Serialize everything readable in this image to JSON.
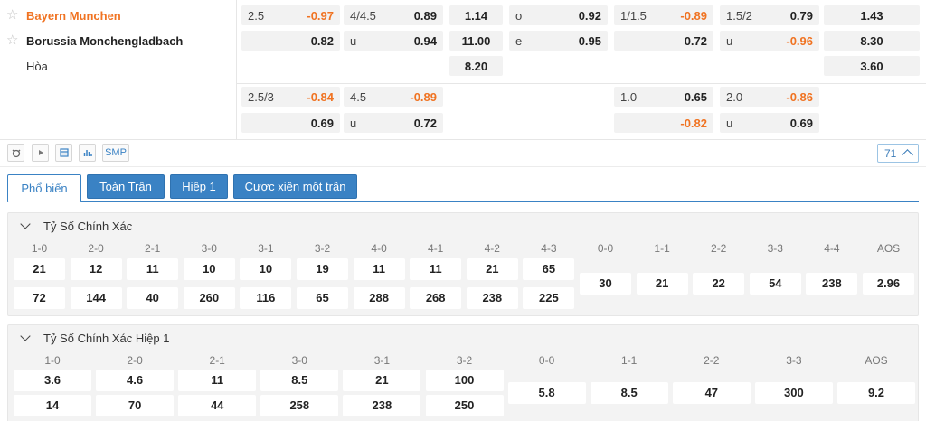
{
  "match": {
    "home": "Bayern Munchen",
    "away": "Borussia Monchengladbach",
    "draw": "Hòa"
  },
  "odds_rows": [
    [
      {
        "col": 0,
        "label": "2.5",
        "value": "-0.97",
        "neg": true
      },
      {
        "col": 1,
        "label": "4/4.5",
        "value": "0.89",
        "neg": false
      },
      {
        "col": 2,
        "label": "",
        "value": "1.14",
        "neg": false
      },
      {
        "col": 3,
        "label": "o",
        "value": "0.92",
        "neg": false
      },
      {
        "col": 4,
        "label": "1/1.5",
        "value": "-0.89",
        "neg": true
      },
      {
        "col": 5,
        "label": "1.5/2",
        "value": "0.79",
        "neg": false
      },
      {
        "col": 6,
        "label": "",
        "value": "1.43",
        "neg": false
      }
    ],
    [
      {
        "col": 0,
        "label": "",
        "value": "0.82",
        "neg": false
      },
      {
        "col": 1,
        "label": "u",
        "value": "0.94",
        "neg": false
      },
      {
        "col": 2,
        "label": "",
        "value": "11.00",
        "neg": false
      },
      {
        "col": 3,
        "label": "e",
        "value": "0.95",
        "neg": false
      },
      {
        "col": 4,
        "label": "",
        "value": "0.72",
        "neg": false
      },
      {
        "col": 5,
        "label": "u",
        "value": "-0.96",
        "neg": true
      },
      {
        "col": 6,
        "label": "",
        "value": "8.30",
        "neg": false
      }
    ],
    [
      {
        "col": 2,
        "label": "",
        "value": "8.20",
        "neg": false
      },
      {
        "col": 6,
        "label": "",
        "value": "3.60",
        "neg": false
      }
    ],
    [
      {
        "col": 0,
        "label": "2.5/3",
        "value": "-0.84",
        "neg": true
      },
      {
        "col": 1,
        "label": "4.5",
        "value": "-0.89",
        "neg": true
      },
      {
        "col": 4,
        "label": "1.0",
        "value": "0.65",
        "neg": false
      },
      {
        "col": 5,
        "label": "2.0",
        "value": "-0.86",
        "neg": true
      }
    ],
    [
      {
        "col": 0,
        "label": "",
        "value": "0.69",
        "neg": false
      },
      {
        "col": 1,
        "label": "u",
        "value": "0.72",
        "neg": false
      },
      {
        "col": 4,
        "label": "",
        "value": "-0.82",
        "neg": true
      },
      {
        "col": 5,
        "label": "u",
        "value": "0.69",
        "neg": false
      }
    ]
  ],
  "toolbar": {
    "smp_label": "SMP",
    "count": "71"
  },
  "tabs": [
    "Phổ biến",
    "Toàn Trận",
    "Hiệp 1",
    "Cược xiên một trận"
  ],
  "section1": {
    "title": "Tỷ Số Chính Xác",
    "home_cols": [
      "1-0",
      "2-0",
      "2-1",
      "3-0",
      "3-1",
      "3-2",
      "4-0",
      "4-1",
      "4-2",
      "4-3"
    ],
    "home_row1": [
      "21",
      "12",
      "11",
      "10",
      "10",
      "19",
      "11",
      "11",
      "21",
      "65"
    ],
    "home_row2": [
      "72",
      "144",
      "40",
      "260",
      "116",
      "65",
      "288",
      "268",
      "238",
      "225"
    ],
    "draw_cols": [
      "0-0",
      "1-1",
      "2-2",
      "3-3",
      "4-4",
      "AOS"
    ],
    "draw_vals": [
      "30",
      "21",
      "22",
      "54",
      "238",
      "2.96"
    ]
  },
  "section2": {
    "title": "Tỷ Số Chính Xác Hiệp 1",
    "home_cols": [
      "1-0",
      "2-0",
      "2-1",
      "3-0",
      "3-1",
      "3-2"
    ],
    "home_row1": [
      "3.6",
      "4.6",
      "11",
      "8.5",
      "21",
      "100"
    ],
    "home_row2": [
      "14",
      "70",
      "44",
      "258",
      "238",
      "250"
    ],
    "draw_cols": [
      "0-0",
      "1-1",
      "2-2",
      "3-3",
      "AOS"
    ],
    "draw_vals": [
      "5.8",
      "8.5",
      "47",
      "300",
      "9.2"
    ]
  },
  "colors": {
    "accent": "#3a82c4",
    "home_team": "#f07322",
    "negative": "#f07322"
  }
}
